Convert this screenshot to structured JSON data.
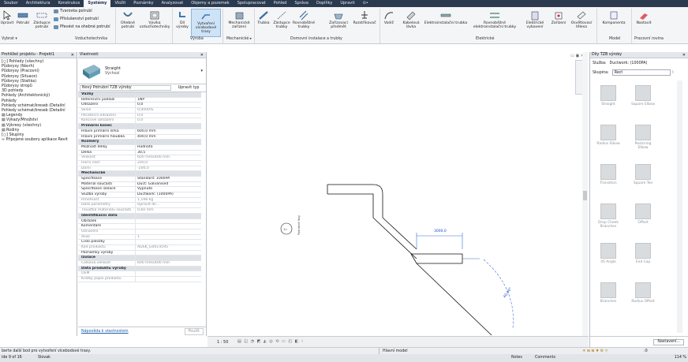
{
  "menu": [
    "Soubor",
    "Architektura",
    "Konstrukce",
    "Systémy",
    "Vložit",
    "Poznámky",
    "Analyzovat",
    "Objemy a pozemek",
    "Spolupracovat",
    "Pohled",
    "Správa",
    "Doplňky",
    "Upravit",
    "⊙•"
  ],
  "menu_active": 3,
  "ribbon": {
    "modify": "Upravit",
    "duct": "Potrubí",
    "placeholder_duct": "Zástupce potrubí",
    "flex_duct": "Tvarovka potrubí",
    "duct_accessory": "Příslušenství potrubí",
    "convert_duct": "Převést na ohebné potrubí",
    "flex": "Ohebné potrubí",
    "terminal": "Vývíka vzduchotechniky",
    "fab_part": "Díl výroby",
    "multipoint": "Vytvoření vícebodové trasy",
    "mech_equip": "Mechanické zařízení",
    "pipe": "Trubka",
    "pipe_placeholder": "Zástupce trubky",
    "parallel": "Rovnoběžné trubky",
    "fitting": "Zařízovací předmět",
    "sprinkler": "Rozstřikovač",
    "wire": "Vodič",
    "cable_tray": "Kabelová lávka",
    "conduit": "Elektroinstalační trubka",
    "parallel_conduit": "Rovnoběžné elektroinstalační trubky",
    "elec_equip": "Elektrické vybavení",
    "device": "Zařízení",
    "lighting": "Osvětlovací tělesa",
    "component": "Komponenta",
    "set": "Nastavit",
    "panels": {
      "select": "Vybrat ▾",
      "hvac": "Vzduchotechnika",
      "fab": "Výroba",
      "mech": "Mechanické ▸",
      "plumbing": "Domovní instalace a trubky",
      "electrical": "Elektrické",
      "model": "Model",
      "workplane": "Pracovní rovina"
    }
  },
  "browser": {
    "title": "Prohlížeč projektu - Projekt1",
    "items": [
      "[○] Pohledy (všechny)",
      "  Půdorysy (Návrh)",
      "  Půdorysy (Pracovní)",
      "  Půdorysy (Situace)",
      "  Půdorysy (Statika)",
      "  Půdorysy stropů",
      "  3D pohledy",
      "  Pohledy (Architektonický)",
      "  Pohledy",
      "  Pohledy schémat/kreseb (Detailní",
      "  Pohledy schémat/kreseb (Detailní",
      "▤ Legendy",
      "▤ Výkazy/Množství",
      "▤ Výkresy (všechny)",
      "▤ Rodiny",
      "[○] Skupiny",
      "∞ Připojené soubory aplikace Revit"
    ]
  },
  "properties": {
    "title": "Vlastnosti",
    "type_name": "Straight",
    "type_sub": "Výchozí",
    "selector": "Nový Potrubní TZB výroby",
    "edit_type": "Upravit typ",
    "help": "Nápověda k vlastnostem",
    "apply": "Použít",
    "rows": [
      {
        "k": "Vazby",
        "v": "",
        "g": true
      },
      {
        "k": "Referenční podlaží",
        "v": "1NP"
      },
      {
        "k": "Odsazení",
        "v": "0,0"
      },
      {
        "k": "Sklon",
        "v": "0,0000%",
        "d": true
      },
      {
        "k": "Počáteční odsazení",
        "v": "0,0",
        "d": true
      },
      {
        "k": "Koncové odsazení",
        "v": "0,0",
        "d": true
      },
      {
        "k": "Primární konec",
        "v": "",
        "g": true
      },
      {
        "k": "Hlavní primární šířka",
        "v": "600,0 mm"
      },
      {
        "k": "Hlavní primární hloubka",
        "v": "400,0 mm"
      },
      {
        "k": "Rozměry",
        "v": "",
        "g": true
      },
      {
        "k": "Možnost délky",
        "v": "Hodnota"
      },
      {
        "k": "Délka",
        "v": "30,5"
      },
      {
        "k": "Velikost",
        "v": "600 mmx400 mm",
        "d": true
      },
      {
        "k": "Horní část",
        "v": "200,0",
        "d": true
      },
      {
        "k": "Dolní",
        "v": "-200,0",
        "d": true
      },
      {
        "k": "Mechanické",
        "v": "",
        "g": true
      },
      {
        "k": "Specifikace",
        "v": "Standard: 1000PA"
      },
      {
        "k": "Materiál součásti",
        "v": "Duct: Galvanised"
      },
      {
        "k": "Specifikace izolace",
        "v": "Vypnuto"
      },
      {
        "k": "Služba výroby",
        "v": "Ductwork: (1000PA)"
      },
      {
        "k": "Hmotnost",
        "v": "1,198 kg",
        "d": true
      },
      {
        "k": "Další parametry",
        "v": "Upravit díl...",
        "d": true
      },
      {
        "k": "Tloušťka materiálu součásti",
        "v": "0,60 mm",
        "d": true
      },
      {
        "k": "Identifikační data",
        "v": "",
        "g": true
      },
      {
        "k": "Obrázek",
        "v": ""
      },
      {
        "k": "Komentáře",
        "v": ""
      },
      {
        "k": "Označení",
        "v": "",
        "d": true
      },
      {
        "k": "Alias",
        "v": "1",
        "d": true
      },
      {
        "k": "Číslo položky",
        "v": ""
      },
      {
        "k": "Kód produktu",
        "v": "ADSK_G0014595",
        "d": true
      },
      {
        "k": "Poznámky výroby",
        "v": ""
      },
      {
        "k": "Izolace",
        "v": "",
        "g": true
      },
      {
        "k": "Celková velikost",
        "v": "600 mmx400 mm",
        "d": true
      },
      {
        "k": "Data produktu výroby",
        "v": "",
        "g": true
      },
      {
        "k": "OEM",
        "v": "",
        "d": true
      },
      {
        "k": "Krátký popis produktu",
        "v": "",
        "d": true
      }
    ]
  },
  "canvas": {
    "dim_label": "3000,0",
    "angle_label": "40,00°",
    "marker_label": "Podrobné řezy"
  },
  "viewbar": {
    "scale": "1 : 50"
  },
  "parts": {
    "title": "Díly TZB výroby",
    "service_label": "Služba:",
    "service_value": "Ductwork: (1000PA)",
    "group_label": "Skupina:",
    "group_value": "Rect",
    "settings": "Nastavení...",
    "items": [
      "Straight",
      "Square Elbow",
      "Radius Elbow",
      "Restoring Elbow",
      "Transition",
      "Square Tee",
      "Drop Cheek Branches",
      "Offset",
      "45 Angle",
      "End Cap",
      "Branches",
      "Radius Offset"
    ]
  },
  "status": {
    "hint": "berte další bod pro vytvoření vícebodové trasy.",
    "model": "Hlavní model",
    "left2": "ide 9 of 16",
    "slovak": "Slovak",
    "notes": "Notes",
    "comments": "Comments",
    "zoom": "114 %",
    "zero": ":0"
  }
}
